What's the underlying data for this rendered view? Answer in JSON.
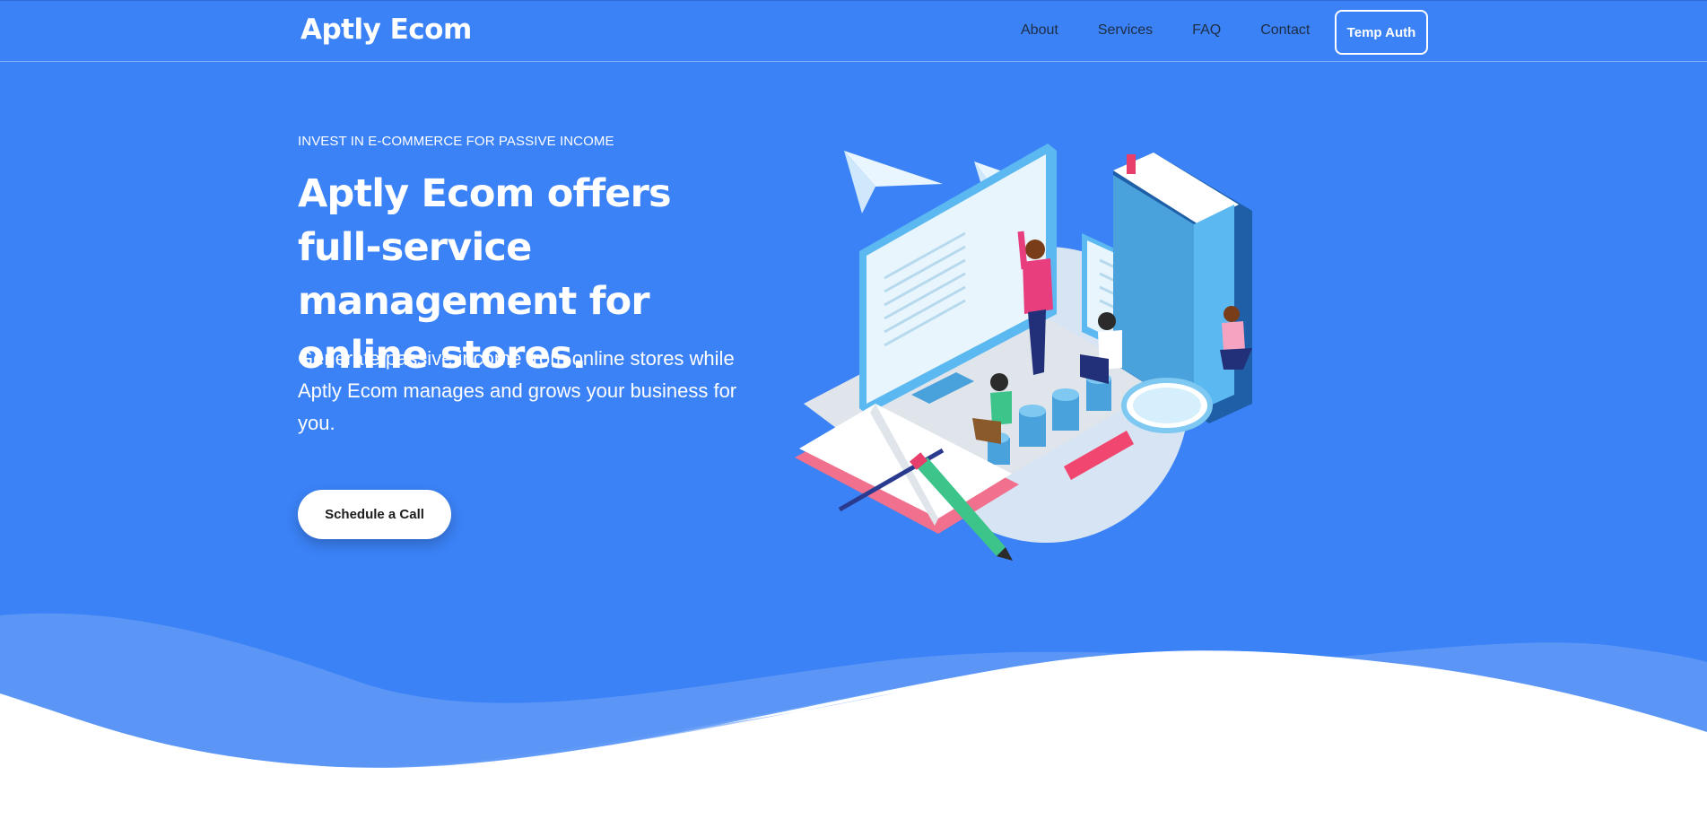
{
  "theme": {
    "primary_blue": "#3b82f6",
    "wave_light": "#5b96f7",
    "wave_mid": "#6aa1f8",
    "text_dark": "#1f2d44",
    "white": "#ffffff"
  },
  "nav": {
    "brand": "Aptly Ecom",
    "links": [
      {
        "label": "About"
      },
      {
        "label": "Services"
      },
      {
        "label": "FAQ"
      },
      {
        "label": "Contact"
      }
    ],
    "auth_button": "Temp Auth"
  },
  "hero": {
    "eyebrow": "INVEST IN E-COMMERCE FOR PASSIVE INCOME",
    "headline": "Aptly Ecom offers full-service management for online stores.",
    "subtext": "Generate passive income from online stores while Aptly Ecom manages and grows your business for you.",
    "cta": "Schedule a Call",
    "illustration_icon": "isometric-ecommerce-illustration"
  }
}
